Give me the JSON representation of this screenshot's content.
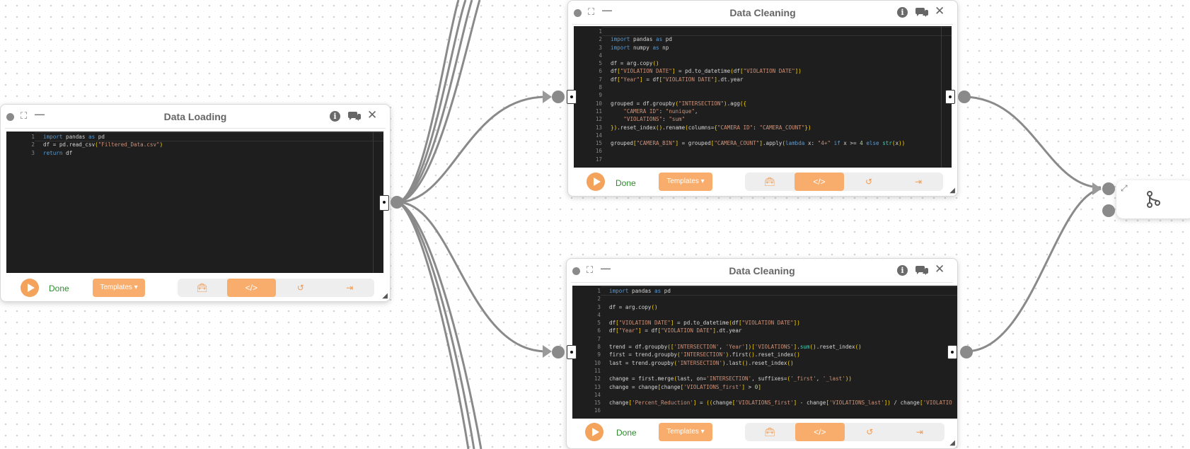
{
  "colors": {
    "accent": "#f9ad6c",
    "play": "#f4a35c",
    "done": "#2f8a2f",
    "wire": "#8a8a8a",
    "editor_bg": "#1e1e1e"
  },
  "nodes": [
    {
      "title": "Data Loading",
      "status": "Done",
      "templates_label": "Templates ▾",
      "line_numbers": "1\n2\n3",
      "code_lines": [
        "import pandas as pd",
        "df = pd.read_csv(\"Filtered_Data.csv\")",
        "return df"
      ]
    },
    {
      "title": "Data Cleaning",
      "status": "Done",
      "templates_label": "Templates ▾",
      "line_numbers": "1\n2\n3\n4\n5\n6\n7\n8\n9\n10\n11\n12\n13\n14\n15\n16\n17",
      "code_lines": [
        "",
        "import pandas as pd",
        "import numpy as np",
        "",
        "df = arg.copy()",
        "df[\"VIOLATION DATE\"] = pd.to_datetime(df[\"VIOLATION DATE\"])",
        "df[\"Year\"] = df[\"VIOLATION DATE\"].dt.year",
        "",
        "",
        "grouped = df.groupby(\"INTERSECTION\").agg({",
        "    \"CAMERA ID\": \"nunique\",",
        "    \"VIOLATIONS\": \"sum\"",
        "}).reset_index().rename(columns={\"CAMERA ID\": \"CAMERA_COUNT\"})",
        "",
        "grouped[\"CAMERA_BIN\"] = grouped[\"CAMERA_COUNT\"].apply(lambda x: \"4+\" if x >= 4 else str(x))",
        "",
        ""
      ]
    },
    {
      "title": "Data Cleaning",
      "status": "Done",
      "templates_label": "Templates ▾",
      "line_numbers": "1\n2\n3\n4\n5\n6\n7\n8\n9\n10\n11\n12\n13\n14\n15\n16",
      "code_lines": [
        "import pandas as pd",
        "",
        "df = arg.copy()",
        "",
        "df[\"VIOLATION DATE\"] = pd.to_datetime(df[\"VIOLATION DATE\"])",
        "df[\"Year\"] = df[\"VIOLATION DATE\"].dt.year",
        "",
        "trend = df.groupby(['INTERSECTION', 'Year'])['VIOLATIONS'].sum().reset_index()",
        "first = trend.groupby('INTERSECTION').first().reset_index()",
        "last = trend.groupby('INTERSECTION').last().reset_index()",
        "",
        "change = first.merge(last, on='INTERSECTION', suffixes=('_first', '_last'))",
        "change = change[change['VIOLATIONS_first'] > 0]",
        "",
        "change['Percent_Reduction'] = ((change['VIOLATIONS_first'] - change['VIOLATIONS_last']) / change['VIOLATIO",
        ""
      ]
    }
  ],
  "toolbar_icons": [
    "toolbox-icon",
    "code-icon",
    "undo-icon",
    "export-icon"
  ],
  "merge_node": {
    "icon": "git-merge-icon"
  }
}
